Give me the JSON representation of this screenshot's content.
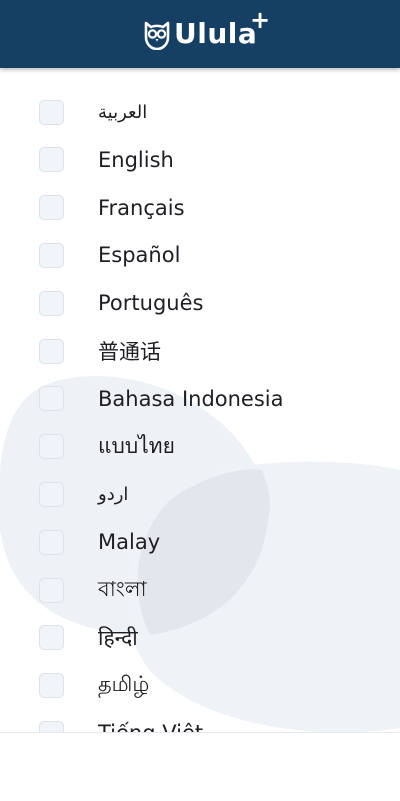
{
  "header": {
    "app_name": "Ulula",
    "plus": "+"
  },
  "languages": [
    {
      "label": "العربية",
      "checked": false
    },
    {
      "label": "English",
      "checked": false
    },
    {
      "label": "Français",
      "checked": false
    },
    {
      "label": "Español",
      "checked": false
    },
    {
      "label": "Português",
      "checked": false
    },
    {
      "label": "普通话",
      "checked": false
    },
    {
      "label": "Bahasa Indonesia",
      "checked": false
    },
    {
      "label": "แบบไทย",
      "checked": false
    },
    {
      "label": "اردو",
      "checked": false
    },
    {
      "label": "Malay",
      "checked": false
    },
    {
      "label": "বাংলা",
      "checked": false
    },
    {
      "label": "हिन्दी",
      "checked": false
    },
    {
      "label": "தமிழ்",
      "checked": false
    },
    {
      "label": "Tiếng Việt",
      "checked": false
    }
  ],
  "colors": {
    "header_bg": "#153f63",
    "blob": "#eef1f5",
    "text": "#1e1e24"
  }
}
